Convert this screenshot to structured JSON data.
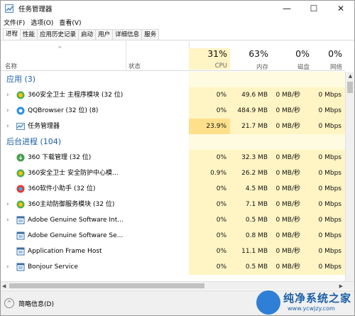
{
  "window": {
    "title": "任务管理器",
    "controls": {
      "minimize": "—",
      "maximize": "☐",
      "close": "✕"
    }
  },
  "menu": [
    "文件(F)",
    "选项(O)",
    "查看(V)"
  ],
  "tabs": [
    "进程",
    "性能",
    "应用历史记录",
    "启动",
    "用户",
    "详细信息",
    "服务"
  ],
  "header": {
    "name_label": "名称",
    "status_label": "状态",
    "columns": [
      {
        "pct": "31%",
        "label": "CPU"
      },
      {
        "pct": "63%",
        "label": "内存"
      },
      {
        "pct": "0%",
        "label": "磁盘"
      },
      {
        "pct": "0%",
        "label": "网络"
      }
    ]
  },
  "groups": {
    "apps": "应用 (3)",
    "background": "后台进程 (104)"
  },
  "rows": [
    {
      "name": "360安全卫士 主程序模块 (32 位)",
      "cpu": "0%",
      "mem": "49.6 MB",
      "disk": "0 MB/秒",
      "net": "0 Mbps",
      "expand": true,
      "icon": "360-safe-icon"
    },
    {
      "name": "QQBrowser (32 位) (8)",
      "cpu": "0%",
      "mem": "484.9 MB",
      "disk": "0 MB/秒",
      "net": "0 Mbps",
      "expand": true,
      "icon": "qqbrowser-icon"
    },
    {
      "name": "任务管理器",
      "cpu": "23.9%",
      "mem": "21.7 MB",
      "disk": "0 MB/秒",
      "net": "0 Mbps",
      "expand": true,
      "icon": "task-manager-icon",
      "cpu_hot": true
    },
    {
      "name": "360 下载管理 (32 位)",
      "cpu": "0%",
      "mem": "32.3 MB",
      "disk": "0 MB/秒",
      "net": "0 Mbps",
      "expand": false,
      "icon": "360-download-icon"
    },
    {
      "name": "360安全卫士 安全防护中心模...",
      "cpu": "0.9%",
      "mem": "26.2 MB",
      "disk": "0 MB/秒",
      "net": "0 Mbps",
      "expand": false,
      "icon": "360-safe-icon"
    },
    {
      "name": "360软件小助手 (32 位)",
      "cpu": "0%",
      "mem": "4.5 MB",
      "disk": "0 MB/秒",
      "net": "0 Mbps",
      "expand": false,
      "icon": "360-helper-icon"
    },
    {
      "name": "360主动防御服务模块 (32 位)",
      "cpu": "0%",
      "mem": "7.1 MB",
      "disk": "0 MB/秒",
      "net": "0 Mbps",
      "expand": true,
      "icon": "360-safe-icon"
    },
    {
      "name": "Adobe Genuine Software Int...",
      "cpu": "0%",
      "mem": "0.5 MB",
      "disk": "0 MB/秒",
      "net": "0 Mbps",
      "expand": true,
      "icon": "service-app-icon"
    },
    {
      "name": "Adobe Genuine Software Se...",
      "cpu": "0%",
      "mem": "0.8 MB",
      "disk": "0 MB/秒",
      "net": "0 Mbps",
      "expand": false,
      "icon": "service-app-icon"
    },
    {
      "name": "Application Frame Host",
      "cpu": "0%",
      "mem": "11.1 MB",
      "disk": "0 MB/秒",
      "net": "0 Mbps",
      "expand": false,
      "icon": "service-app-icon"
    },
    {
      "name": "Bonjour Service",
      "cpu": "0%",
      "mem": "0.5 MB",
      "disk": "0 MB/秒",
      "net": "0 Mbps",
      "expand": true,
      "icon": "service-app-icon"
    }
  ],
  "footer": {
    "label": "简略信息(D)",
    "toggle": "^"
  },
  "watermark": {
    "brand": "纯净系统之家",
    "url": "www.ycwjzy.com"
  },
  "colors": {
    "accent": "#1a5fa8",
    "heat_light": "#fff4c4",
    "heat_mid": "#ffe08a"
  }
}
